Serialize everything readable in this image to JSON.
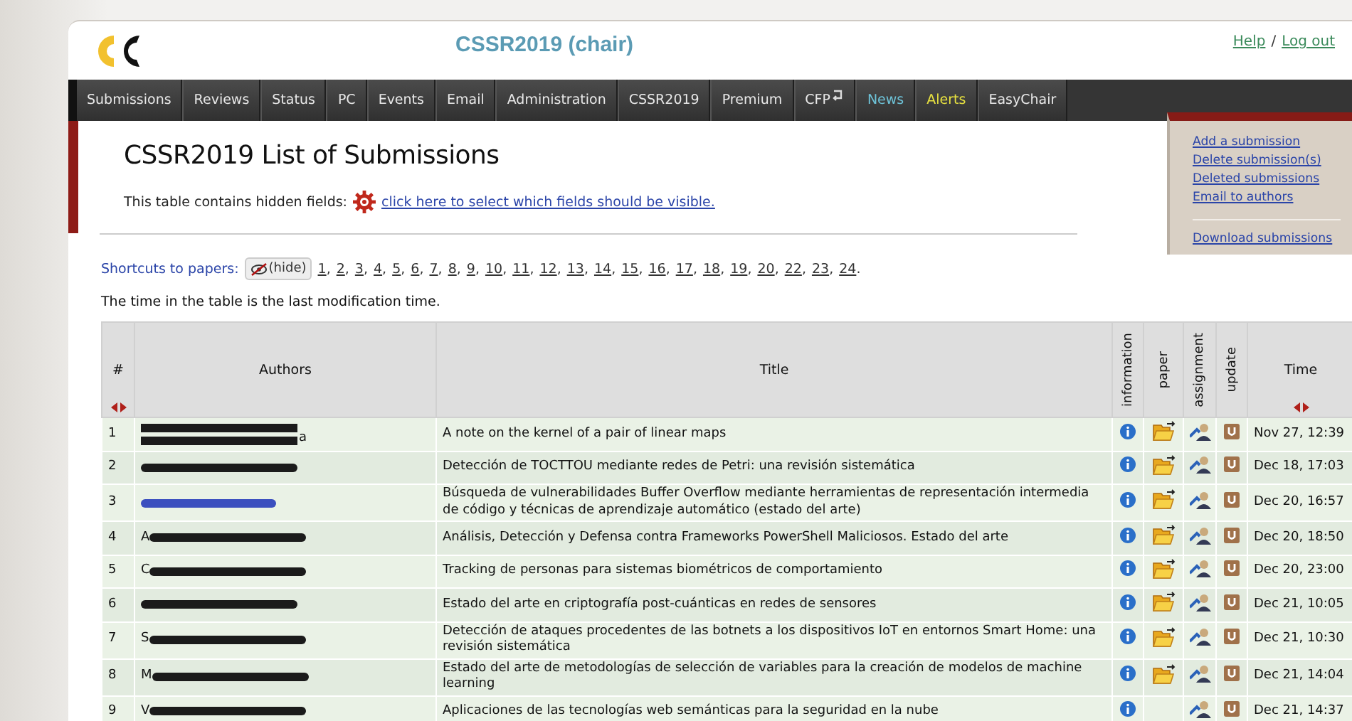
{
  "header": {
    "title": "CSSR2019 (chair)",
    "links": [
      "Help",
      "Log out"
    ],
    "separator": "/"
  },
  "nav": [
    {
      "label": "Submissions",
      "kind": "plain",
      "icon": false
    },
    {
      "label": "Reviews",
      "kind": "plain",
      "icon": false
    },
    {
      "label": "Status",
      "kind": "plain",
      "icon": false
    },
    {
      "label": "PC",
      "kind": "plain",
      "icon": false
    },
    {
      "label": "Events",
      "kind": "plain",
      "icon": false
    },
    {
      "label": "Email",
      "kind": "plain",
      "icon": false
    },
    {
      "label": "Administration",
      "kind": "plain",
      "icon": false
    },
    {
      "label": "CSSR2019",
      "kind": "plain",
      "icon": false
    },
    {
      "label": "Premium",
      "kind": "plain",
      "icon": false
    },
    {
      "label": "CFP",
      "kind": "plain",
      "icon": true
    },
    {
      "label": "News",
      "kind": "news",
      "icon": false
    },
    {
      "label": "Alerts",
      "kind": "alerts",
      "icon": false
    },
    {
      "label": "EasyChair",
      "kind": "plain",
      "icon": false
    }
  ],
  "side_menu": {
    "groups": [
      [
        "Add a submission",
        "Delete submission(s)",
        "Deleted submissions",
        "Email to authors"
      ],
      [
        "Download submissions"
      ]
    ]
  },
  "page_title": "CSSR2019 List of Submissions",
  "hidden_fields": {
    "text": "This table contains hidden fields:",
    "link": "click here to select which fields should be visible."
  },
  "shortcuts": {
    "label": "Shortcuts to papers:",
    "hide_button": "(hide)",
    "separator": ",",
    "end": ".",
    "numbers": [
      "1",
      "2",
      "3",
      "4",
      "5",
      "6",
      "7",
      "8",
      "9",
      "10",
      "11",
      "12",
      "13",
      "14",
      "15",
      "16",
      "17",
      "18",
      "19",
      "20",
      "22",
      "23",
      "24"
    ]
  },
  "note": "The time in the table is the last modification time.",
  "table": {
    "columns": [
      {
        "label": "#",
        "vertical": false,
        "sortable": true
      },
      {
        "label": "Authors",
        "vertical": false,
        "sortable": false
      },
      {
        "label": "Title",
        "vertical": false,
        "sortable": false
      },
      {
        "label": "information",
        "vertical": true,
        "sortable": false
      },
      {
        "label": "paper",
        "vertical": true,
        "sortable": false
      },
      {
        "label": "assignment",
        "vertical": true,
        "sortable": false
      },
      {
        "label": "update",
        "vertical": true,
        "sortable": false
      },
      {
        "label": "Time",
        "vertical": false,
        "sortable": true
      }
    ],
    "rows": [
      {
        "number": "1",
        "author": {
          "suffix": "a",
          "two_lines": true,
          "link": false
        },
        "title": "A note on the kernel of a pair of linear maps",
        "paper": true,
        "time": "Nov 27, 12:39"
      },
      {
        "number": "2",
        "author": {
          "two_lines": false,
          "link": false
        },
        "title": "Detección de TOCTTOU mediante redes de Petri: una revisión sistemática",
        "paper": true,
        "time": "Dec 18, 17:03"
      },
      {
        "number": "3",
        "author": {
          "two_lines": false,
          "link": true
        },
        "title": "Búsqueda de vulnerabilidades Buffer Overflow mediante herramientas de representación intermedia de código y técnicas de aprendizaje automático (estado del arte)",
        "paper": true,
        "time": "Dec 20, 16:57"
      },
      {
        "number": "4",
        "author": {
          "prefix": "A",
          "two_lines": false,
          "link": false
        },
        "title": "Análisis, Detección y Defensa contra Frameworks PowerShell Maliciosos. Estado del arte",
        "paper": true,
        "time": "Dec 20, 18:50"
      },
      {
        "number": "5",
        "author": {
          "prefix": "C",
          "two_lines": false,
          "link": false
        },
        "title": "Tracking de personas para sistemas biométricos de comportamiento",
        "paper": true,
        "time": "Dec 20, 23:00"
      },
      {
        "number": "6",
        "author": {
          "two_lines": false,
          "link": false
        },
        "title": "Estado del arte en criptografía post-cuánticas en redes de sensores",
        "paper": true,
        "time": "Dec 21, 10:05"
      },
      {
        "number": "7",
        "author": {
          "prefix": "S",
          "two_lines": false,
          "link": false
        },
        "title": "Detección de ataques procedentes de las botnets a los dispositivos IoT en entornos Smart Home: una revisión sistemática",
        "paper": true,
        "time": "Dec 21, 10:30"
      },
      {
        "number": "8",
        "author": {
          "prefix": "M",
          "two_lines": false,
          "link": false
        },
        "title": "Estado del arte de metodologías de selección de variables para la creación de modelos de machine learning",
        "paper": true,
        "time": "Dec 21, 14:04"
      },
      {
        "number": "9",
        "author": {
          "prefix": "V",
          "two_lines": false,
          "link": false
        },
        "title": "Aplicaciones de las tecnologías web semánticas para la seguridad en la nube",
        "paper": false,
        "time": "Dec 21, 14:37"
      }
    ]
  }
}
